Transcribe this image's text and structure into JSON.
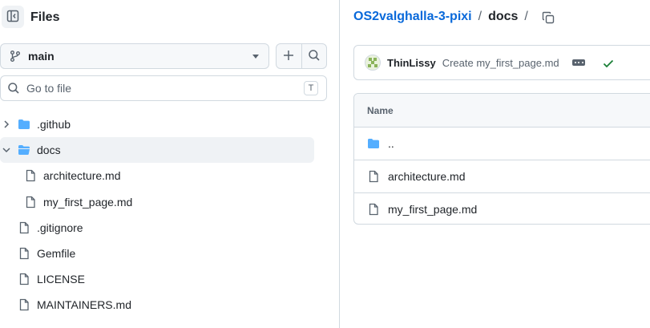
{
  "sidebar": {
    "title": "Files",
    "branch": "main",
    "goto_placeholder": "Go to file",
    "goto_shortcut": "T",
    "tree": [
      {
        "label": ".github",
        "kind": "folder",
        "expanded": false
      },
      {
        "label": "docs",
        "kind": "folder",
        "expanded": true,
        "selected": true
      },
      {
        "label": "architecture.md",
        "kind": "file"
      },
      {
        "label": "my_first_page.md",
        "kind": "file"
      },
      {
        "label": ".gitignore",
        "kind": "file"
      },
      {
        "label": "Gemfile",
        "kind": "file"
      },
      {
        "label": "LICENSE",
        "kind": "file"
      },
      {
        "label": "MAINTAINERS.md",
        "kind": "file"
      }
    ]
  },
  "breadcrumb": {
    "repo": "OS2valghalla-3-pixi",
    "separator": "/",
    "current": "docs"
  },
  "commit": {
    "author": "ThinLissy",
    "message": "Create my_first_page.md",
    "status": "success"
  },
  "file_table": {
    "header": "Name",
    "rows": [
      {
        "label": "..",
        "kind": "folder"
      },
      {
        "label": "architecture.md",
        "kind": "file"
      },
      {
        "label": "my_first_page.md",
        "kind": "file"
      }
    ]
  },
  "colors": {
    "link": "#0969da",
    "folder": "#54aeff",
    "success": "#1a7f37",
    "border": "#d1d9e0",
    "muted": "#59636e"
  }
}
